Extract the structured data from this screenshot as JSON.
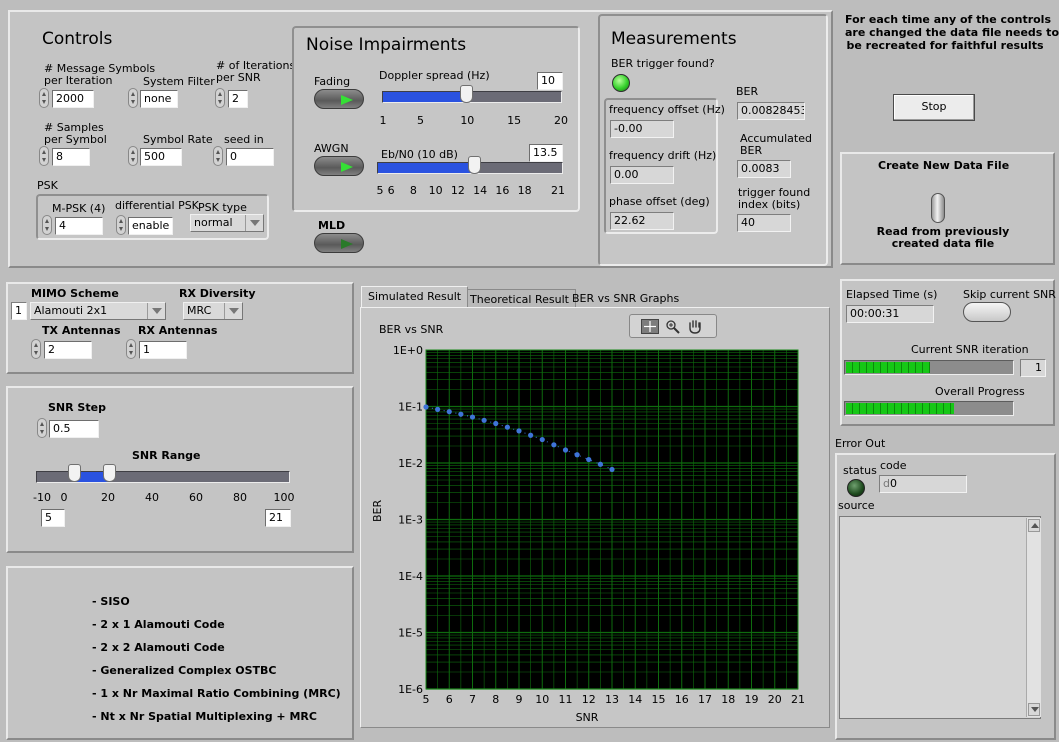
{
  "controls": {
    "title": "Controls",
    "num_symbols_label": "# Message Symbols\nper Iteration",
    "num_symbols": "2000",
    "system_filter_label": "System Filter",
    "system_filter": "none",
    "iterations_label": "# of Iterations\nper SNR",
    "iterations": "2",
    "samples_label": "# Samples\nper Symbol",
    "samples": "8",
    "symbol_rate_label": "Symbol Rate",
    "symbol_rate": "500",
    "seed_label": "seed in",
    "seed": "0",
    "psk_label": "PSK",
    "mpsk_label": "M-PSK (4)",
    "mpsk": "4",
    "diff_psk_label": "differential PSK",
    "diff_psk": "enable",
    "psk_type_label": "PSK type",
    "psk_type": "normal"
  },
  "noise": {
    "title": "Noise Impairments",
    "fading_label": "Fading",
    "doppler_label": "Doppler spread (Hz)",
    "doppler_value": "10",
    "doppler_ticks": [
      "1",
      "5",
      "10",
      "15",
      "20"
    ],
    "doppler_min": 1,
    "doppler_max": 20,
    "doppler": 10,
    "awgn_label": "AWGN",
    "ebn0_label": "Eb/N0 (10 dB)",
    "ebn0_value": "13.5",
    "ebn0_ticks": [
      "5",
      "6",
      "8",
      "10",
      "12",
      "14",
      "16",
      "18",
      "21"
    ],
    "ebn0_min": 5,
    "ebn0_max": 21,
    "ebn0": 13.5,
    "mld_label": "MLD"
  },
  "measurements": {
    "title": "Measurements",
    "ber_trigger_label": "BER trigger found?",
    "freq_offset_label": "frequency offset (Hz)",
    "freq_offset": "-0.00",
    "freq_drift_label": "frequency drift (Hz)",
    "freq_drift": "0.00",
    "phase_offset_label": "phase offset (deg)",
    "phase_offset": "22.62",
    "ber_label": "BER",
    "ber": "0.00828453",
    "acc_ber_label": "Accumulated\nBER",
    "acc_ber": "0.0083",
    "trigger_index_label": "trigger found\nindex (bits)",
    "trigger_index": "40"
  },
  "notice": {
    "text": "For each time any of the controls\nare changed the data file needs to\nbe recreated for faithful results",
    "stop_label": "Stop"
  },
  "datafile": {
    "create_label": "Create New Data File",
    "read_label": "Read from previously\ncreated data file"
  },
  "mimo": {
    "scheme_label": "MIMO Scheme",
    "scheme_index": "1",
    "scheme": "Alamouti 2x1",
    "rx_diversity_label": "RX Diversity",
    "rx_diversity": "MRC",
    "tx_label": "TX Antennas",
    "tx": "2",
    "rx_label": "RX Antennas",
    "rx": "1"
  },
  "snr": {
    "step_label": "SNR Step",
    "step": "0.5",
    "range_label": "SNR Range",
    "range_ticks": [
      "-10",
      "0",
      "20",
      "40",
      "60",
      "80",
      "100"
    ],
    "min_value": "5",
    "max_value": "21",
    "scale_min": -10,
    "scale_max": 100,
    "low": 5,
    "high": 21
  },
  "schemes_list": [
    "- SISO",
    "- 2 x 1 Alamouti Code",
    "- 2 x 2 Alamouti Code",
    "- Generalized Complex OSTBC",
    "- 1 x Nr Maximal Ratio Combining (MRC)",
    "- Nt x Nr Spatial Multiplexing + MRC"
  ],
  "tabs": {
    "simulated": "Simulated Result",
    "theoretical": "Theoretical Result",
    "ber_vs_snr": "BER vs SNR Graphs"
  },
  "progress": {
    "elapsed_label": "Elapsed Time (s)",
    "elapsed": "00:00:31",
    "skip_label": "Skip current SNR",
    "current_label": "Current SNR iteration",
    "current_value": "1",
    "current_fraction": 0.5,
    "overall_label": "Overall Progress",
    "overall_fraction": 0.64
  },
  "error_out": {
    "title": "Error Out",
    "status_label": "status",
    "code_label": "code",
    "code_prefix": "d",
    "code": "0",
    "source_label": "source"
  },
  "colors": {
    "plot_bg": "#000000",
    "grid": "#0e6b0e",
    "series": "#3f74d8",
    "led_green": "#35e035"
  },
  "chart_data": {
    "type": "scatter",
    "title": "BER vs SNR",
    "xlabel": "SNR",
    "ylabel": "BER",
    "xlim": [
      5,
      21
    ],
    "ylim": [
      1e-06,
      1
    ],
    "yscale": "log",
    "x_ticks": [
      "5",
      "6",
      "7",
      "8",
      "9",
      "10",
      "11",
      "12",
      "13",
      "14",
      "15",
      "16",
      "17",
      "18",
      "19",
      "20",
      "21"
    ],
    "y_ticks": [
      "1E+0",
      "1E-1",
      "1E-2",
      "1E-3",
      "1E-4",
      "1E-5",
      "1E-6"
    ],
    "grid": true,
    "series": [
      {
        "x": [
          5,
          5.5,
          6,
          6.5,
          7,
          7.5,
          8,
          8.5,
          9,
          9.5,
          10,
          10.5,
          11,
          11.5,
          12,
          12.5,
          13
        ],
        "values": [
          0.098,
          0.089,
          0.081,
          0.073,
          0.065,
          0.057,
          0.05,
          0.043,
          0.037,
          0.031,
          0.026,
          0.021,
          0.017,
          0.014,
          0.0115,
          0.0095,
          0.0077
        ]
      }
    ]
  }
}
